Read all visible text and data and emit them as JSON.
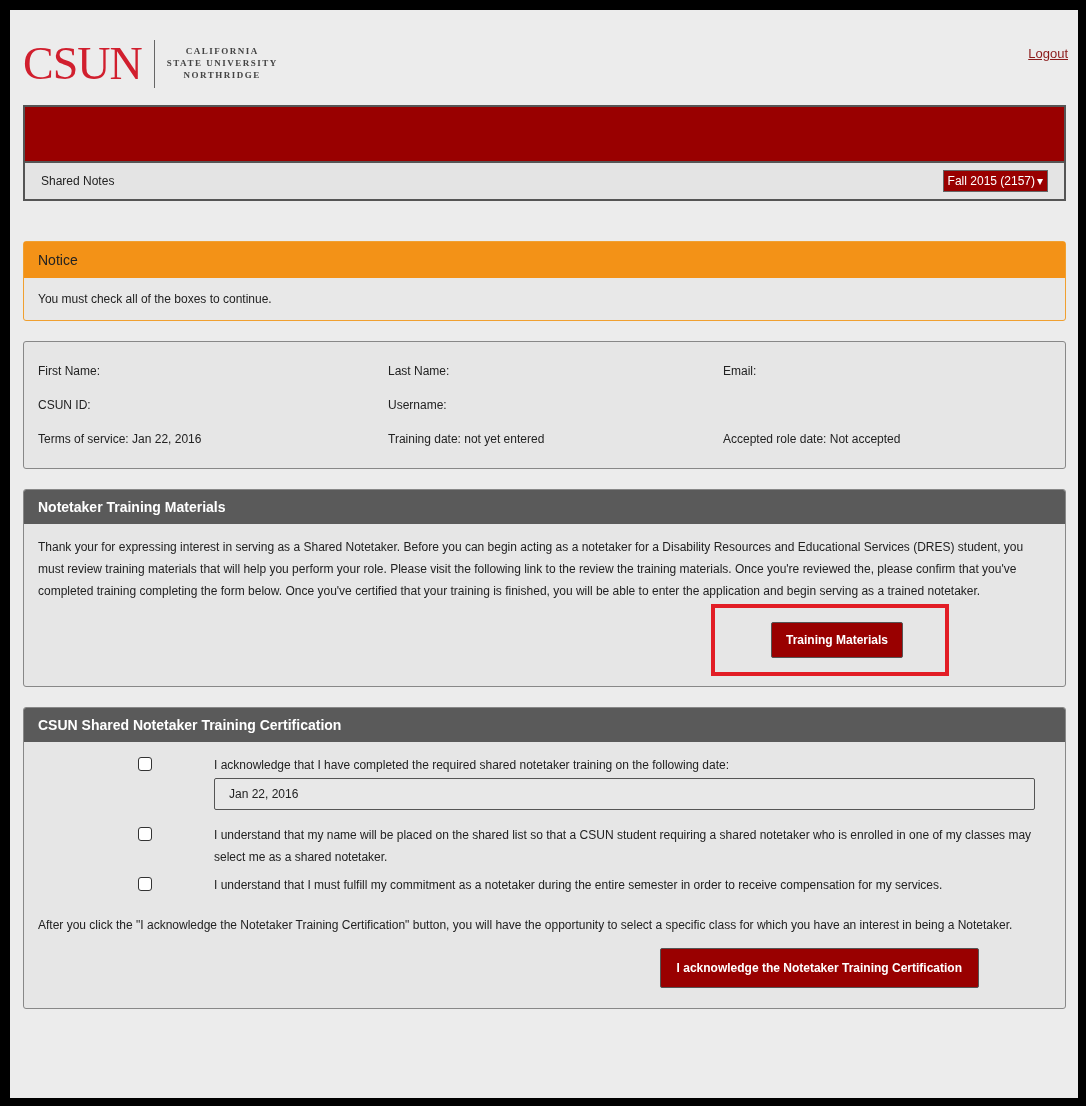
{
  "header": {
    "logo": "CSUN",
    "logo_lines": [
      "CALIFORNIA",
      "STATE UNIVERSITY",
      "NORTHRIDGE"
    ],
    "logout": "Logout"
  },
  "nav": {
    "title": "Shared Notes",
    "term": "Fall 2015 (2157)",
    "term_caret": "▾"
  },
  "notice": {
    "title": "Notice",
    "message": "You must check all of the boxes to continue."
  },
  "profile": {
    "rows": [
      [
        "First Name:",
        "Last Name:",
        "Email:"
      ],
      [
        "CSUN ID:",
        "Username:"
      ],
      [
        "Terms of service: Jan 22, 2016",
        "Training date: not yet entered",
        "Accepted role date: Not accepted"
      ]
    ]
  },
  "training": {
    "title": "Notetaker Training Materials",
    "text": "Thank your for expressing interest in serving as a Shared Notetaker. Before you can begin acting as a notetaker for a Disability Resources and Educational Services (DRES) student, you must review training materials that will help you perform your role. Please visit the following link to the review the training materials. Once you're reviewed the, please confirm that you've completed training completing the form below. Once you've certified that your training is finished, you will be able to enter the application and begin serving as a trained notetaker.",
    "button": "Training Materials",
    "highlighted": true
  },
  "certification": {
    "title": "CSUN Shared Notetaker Training Certification",
    "items": [
      {
        "text": "I acknowledge that I have completed the required shared notetaker training on the following date:",
        "checked": false,
        "date": "Jan 22, 2016"
      },
      {
        "text": "I understand that my name will be placed on the shared list so that a CSUN student requiring a shared notetaker who is enrolled in one of my classes may select me as a shared notetaker.",
        "checked": false
      },
      {
        "text": "I understand that I must fulfill my commitment as a notetaker during the entire semester in order to receive compensation for my services.",
        "checked": false
      }
    ],
    "note": "After you click the \"I acknowledge the Notetaker Training Certification\" button, you will have the opportunity to select a specific class for which you have an interest in being a Notetaker.",
    "button": "I acknowledge the Notetaker Training Certification"
  }
}
